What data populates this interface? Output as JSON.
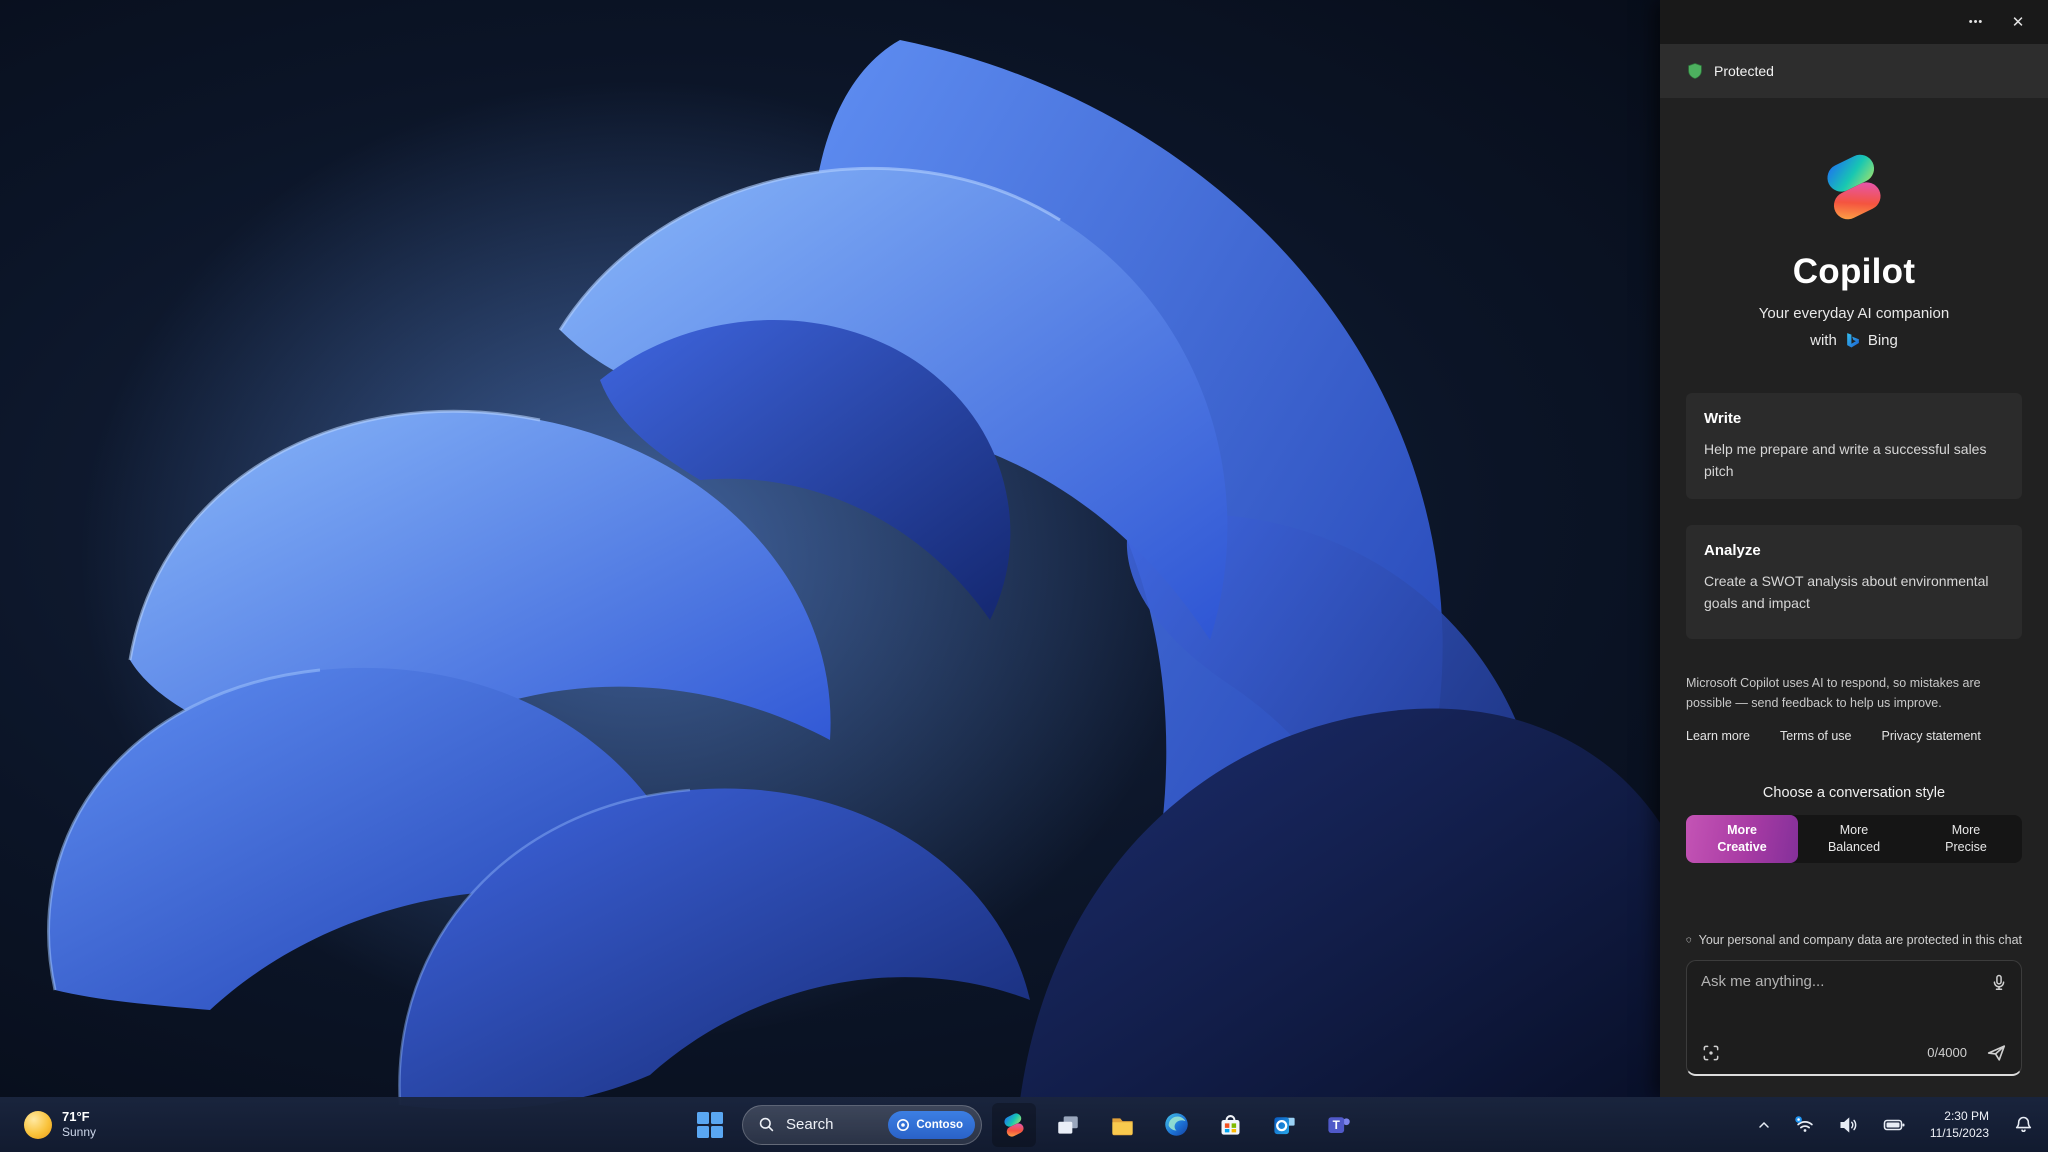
{
  "copilot": {
    "topbar": {
      "more_glyph": "•••",
      "close_glyph": "✕"
    },
    "protected_label": "Protected",
    "title": "Copilot",
    "subtitle": "Your everyday AI companion",
    "with_label": "with",
    "bing_label": "Bing",
    "cards": [
      {
        "title": "Write",
        "body": "Help me prepare and write a successful sales pitch"
      },
      {
        "title": "Analyze",
        "body": "Create a SWOT analysis about environmental goals and impact"
      }
    ],
    "disclaimer": "Microsoft Copilot uses AI to respond, so mistakes are possible — send feedback to help us improve.",
    "links": [
      "Learn more",
      "Terms of use",
      "Privacy statement"
    ],
    "style_heading": "Choose a conversation style",
    "styles": [
      {
        "line1": "More",
        "line2": "Creative",
        "selected": true
      },
      {
        "line1": "More",
        "line2": "Balanced",
        "selected": false
      },
      {
        "line1": "More",
        "line2": "Precise",
        "selected": false
      }
    ],
    "privacy_note": "Your personal and company data are protected in this chat",
    "input": {
      "placeholder": "Ask me anything...",
      "counter": "0/4000"
    },
    "accent_selected_style": "#a83ba4",
    "protected_shield_color": "#4db05f"
  },
  "taskbar": {
    "weather": {
      "temp": "71°F",
      "condition": "Sunny"
    },
    "search": {
      "label": "Search",
      "badge": "Contoso"
    },
    "apps": [
      "copilot",
      "task-view",
      "file-explorer",
      "edge",
      "store",
      "outlook",
      "teams"
    ],
    "clock": {
      "time": "2:30 PM",
      "date": "11/15/2023"
    }
  }
}
